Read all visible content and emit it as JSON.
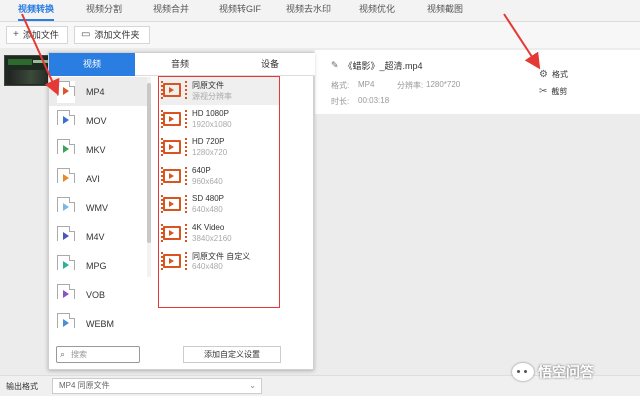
{
  "top_tabs": [
    {
      "label": "视频转换",
      "active": true
    },
    {
      "label": "视频分割",
      "active": false
    },
    {
      "label": "视频合并",
      "active": false
    },
    {
      "label": "视频转GIF",
      "active": false
    },
    {
      "label": "视频去水印",
      "active": false
    },
    {
      "label": "视频优化",
      "active": false
    },
    {
      "label": "视频截图",
      "active": false
    }
  ],
  "toolbar": {
    "add_file": "添加文件",
    "add_folder": "添加文件夹"
  },
  "file": {
    "name": "《蜡影》_超清.mp4",
    "format_label": "格式:",
    "format_value": "MP4",
    "resolution_label": "分辨率:",
    "resolution_value": "1280*720",
    "duration_label": "时长:",
    "duration_value": "00:03:18",
    "action_format": "格式",
    "action_cut": "截剪"
  },
  "popup": {
    "tabs": [
      {
        "label": "视频",
        "active": true
      },
      {
        "label": "音频",
        "active": false
      },
      {
        "label": "设备",
        "active": false
      }
    ],
    "formats": [
      {
        "name": "MP4",
        "color": "#e0522a",
        "selected": true
      },
      {
        "name": "MOV",
        "color": "#3c6fd1",
        "selected": false
      },
      {
        "name": "MKV",
        "color": "#3aa55a",
        "selected": false
      },
      {
        "name": "AVI",
        "color": "#e88a2a",
        "selected": false
      },
      {
        "name": "WMV",
        "color": "#7bb7e0",
        "selected": false
      },
      {
        "name": "M4V",
        "color": "#4a57b8",
        "selected": false
      },
      {
        "name": "MPG",
        "color": "#2bb39a",
        "selected": false
      },
      {
        "name": "VOB",
        "color": "#8a52c7",
        "selected": false
      },
      {
        "name": "WEBM",
        "color": "#4a8fd6",
        "selected": false
      }
    ],
    "presets": [
      {
        "title": "同原文件",
        "sub": "源视分辨率",
        "selected": true
      },
      {
        "title": "HD 1080P",
        "sub": "1920x1080",
        "selected": false
      },
      {
        "title": "HD 720P",
        "sub": "1280x720",
        "selected": false
      },
      {
        "title": "640P",
        "sub": "960x640",
        "selected": false
      },
      {
        "title": "SD 480P",
        "sub": "640x480",
        "selected": false
      },
      {
        "title": "4K Video",
        "sub": "3840x2160",
        "selected": false
      },
      {
        "title": "同原文件 自定义",
        "sub": "640x480",
        "selected": false
      }
    ],
    "search_placeholder": "搜索",
    "add_custom": "添加自定义设置"
  },
  "bottom": {
    "output_label": "输出格式",
    "output_value": "MP4  同原文件"
  },
  "watermark": {
    "text": "悟空问答"
  },
  "colors": {
    "accent": "#2a7de1",
    "annotation": "#e53935"
  }
}
